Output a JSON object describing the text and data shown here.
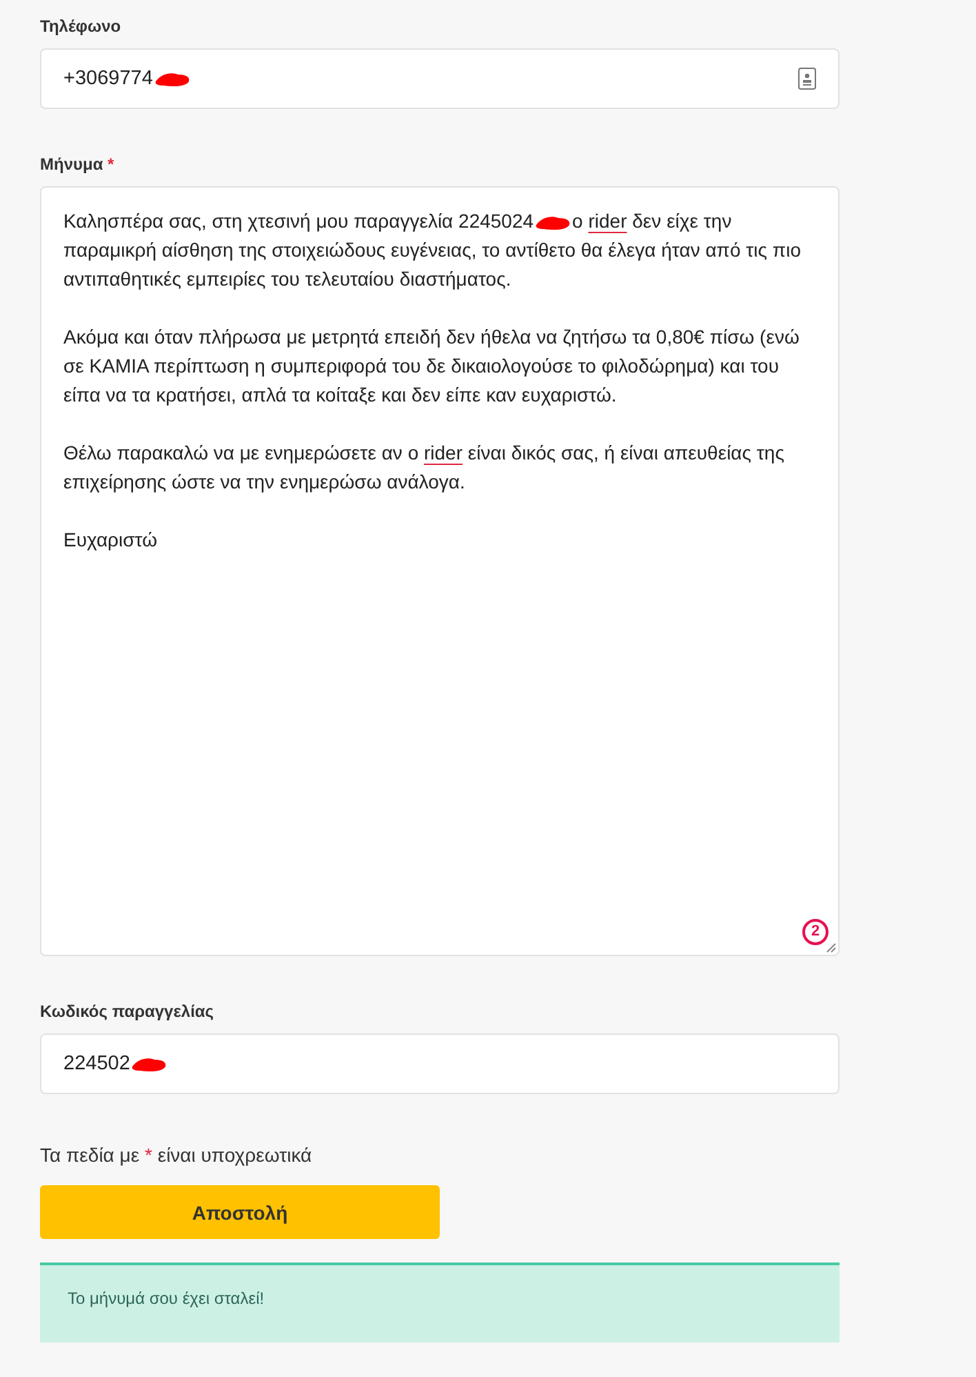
{
  "phone": {
    "label": "Τηλέφωνο",
    "value": "+3069774",
    "redacted": true
  },
  "message": {
    "label": "Μήνυμα",
    "required": true,
    "paragraphs": [
      [
        {
          "kind": "text",
          "text": "Καλησπέρα σας, στη χτεσινή μου παραγγελία 2245024"
        },
        {
          "kind": "redaction"
        },
        {
          "kind": "text",
          "text": "ο "
        },
        {
          "kind": "misspelled",
          "text": "rider"
        },
        {
          "kind": "text",
          "text": " δεν είχε την παραμικρή αίσθηση της στοιχειώδους ευγένειας, το αντίθετο θα έλεγα ήταν από τις πιο αντιπαθητικές εμπειρίες του τελευταίου διαστήματος."
        }
      ],
      [
        {
          "kind": "text",
          "text": "Ακόμα και όταν πλήρωσα με μετρητά επειδή δεν ήθελα να ζητήσω τα 0,80€ πίσω (ενώ σε ΚΑΜΙΑ περίπτωση η συμπεριφορά του δε δικαιολογούσε το φιλοδώρημα) και του είπα να τα κρατήσει, απλά τα κοίταξε και δεν είπε καν ευχαριστώ."
        }
      ],
      [
        {
          "kind": "text",
          "text": "Θέλω παρακαλώ να με ενημερώσετε αν ο "
        },
        {
          "kind": "misspelled",
          "text": "rider"
        },
        {
          "kind": "text",
          "text": " είναι δικός σας, ή είναι απευθείας της επιχείρησης ώστε να την ενημερώσω ανάλογα."
        }
      ],
      [
        {
          "kind": "text",
          "text": "Ευχαριστώ"
        }
      ]
    ],
    "issue_count": "2"
  },
  "order_code": {
    "label": "Κωδικός παραγγελίας",
    "value": "224502",
    "redacted": true
  },
  "required_note": {
    "before": "Τα πεδία με",
    "mark": "*",
    "after": "είναι υποχρεωτικά"
  },
  "submit_button": "Αποστολή",
  "success_message": "Το μήνυμά σου έχει σταλεί!"
}
